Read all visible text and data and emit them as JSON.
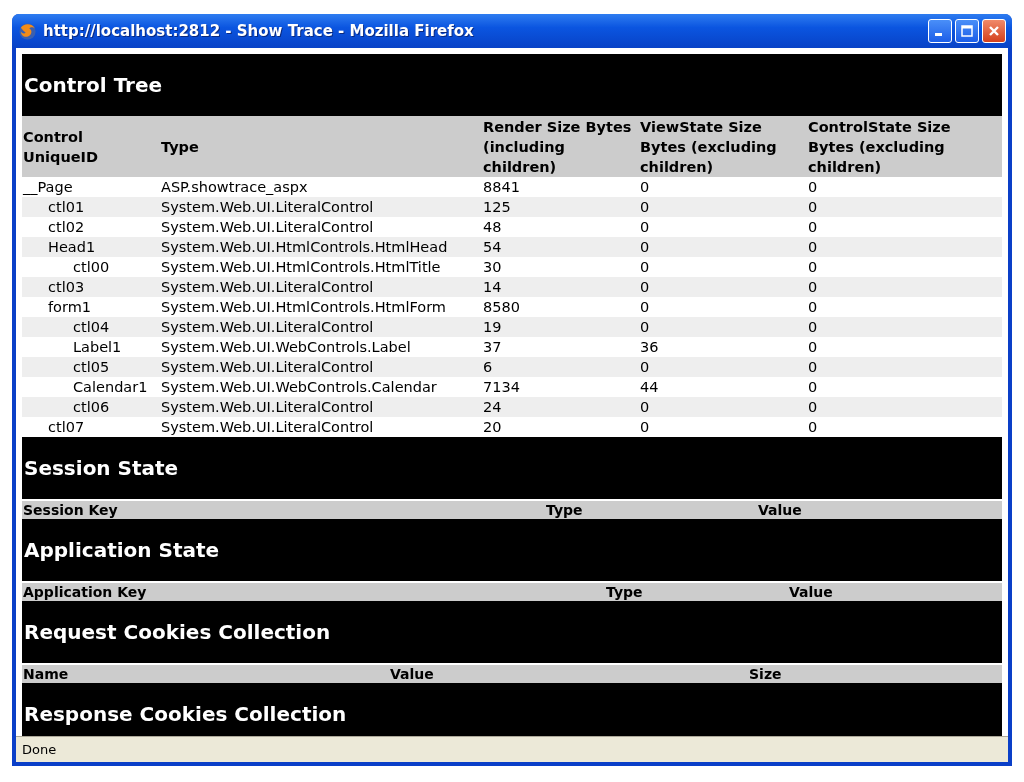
{
  "window": {
    "title": "http://localhost:2812 - Show Trace - Mozilla Firefox"
  },
  "control_tree": {
    "title": "Control Tree",
    "columns": [
      "Control UniqueID",
      "Type",
      "Render Size Bytes (including children)",
      "ViewState Size Bytes (excluding children)",
      "ControlState Size Bytes (excluding children)"
    ],
    "rows": [
      {
        "id": "__Page",
        "type": "ASP.showtrace_aspx",
        "render": "8841",
        "viewstate": "0",
        "controlstate": "0",
        "children": [
          {
            "id": "ctl01",
            "type": "System.Web.UI.LiteralControl",
            "render": "125",
            "viewstate": "0",
            "controlstate": "0"
          },
          {
            "id": "ctl02",
            "type": "System.Web.UI.LiteralControl",
            "render": "48",
            "viewstate": "0",
            "controlstate": "0"
          },
          {
            "id": "Head1",
            "type": "System.Web.UI.HtmlControls.HtmlHead",
            "render": "54",
            "viewstate": "0",
            "controlstate": "0",
            "children": [
              {
                "id": "ctl00",
                "type": "System.Web.UI.HtmlControls.HtmlTitle",
                "render": "30",
                "viewstate": "0",
                "controlstate": "0"
              }
            ]
          },
          {
            "id": "ctl03",
            "type": "System.Web.UI.LiteralControl",
            "render": "14",
            "viewstate": "0",
            "controlstate": "0"
          },
          {
            "id": "form1",
            "type": "System.Web.UI.HtmlControls.HtmlForm",
            "render": "8580",
            "viewstate": "0",
            "controlstate": "0",
            "children": [
              {
                "id": "ctl04",
                "type": "System.Web.UI.LiteralControl",
                "render": "19",
                "viewstate": "0",
                "controlstate": "0"
              },
              {
                "id": "Label1",
                "type": "System.Web.UI.WebControls.Label",
                "render": "37",
                "viewstate": "36",
                "controlstate": "0"
              },
              {
                "id": "ctl05",
                "type": "System.Web.UI.LiteralControl",
                "render": "6",
                "viewstate": "0",
                "controlstate": "0"
              },
              {
                "id": "Calendar1",
                "type": "System.Web.UI.WebControls.Calendar",
                "render": "7134",
                "viewstate": "44",
                "controlstate": "0"
              },
              {
                "id": "ctl06",
                "type": "System.Web.UI.LiteralControl",
                "render": "24",
                "viewstate": "0",
                "controlstate": "0"
              }
            ]
          },
          {
            "id": "ctl07",
            "type": "System.Web.UI.LiteralControl",
            "render": "20",
            "viewstate": "0",
            "controlstate": "0"
          }
        ]
      }
    ]
  },
  "sections": [
    {
      "title": "Session State",
      "columns": [
        "Session Key",
        "Type",
        "Value"
      ]
    },
    {
      "title": "Application State",
      "columns": [
        "Application Key",
        "Type",
        "Value"
      ]
    },
    {
      "title": "Request Cookies Collection",
      "columns": [
        "Name",
        "Value",
        "Size"
      ]
    },
    {
      "title": "Response Cookies Collection"
    }
  ],
  "status_bar": {
    "text": "Done"
  }
}
